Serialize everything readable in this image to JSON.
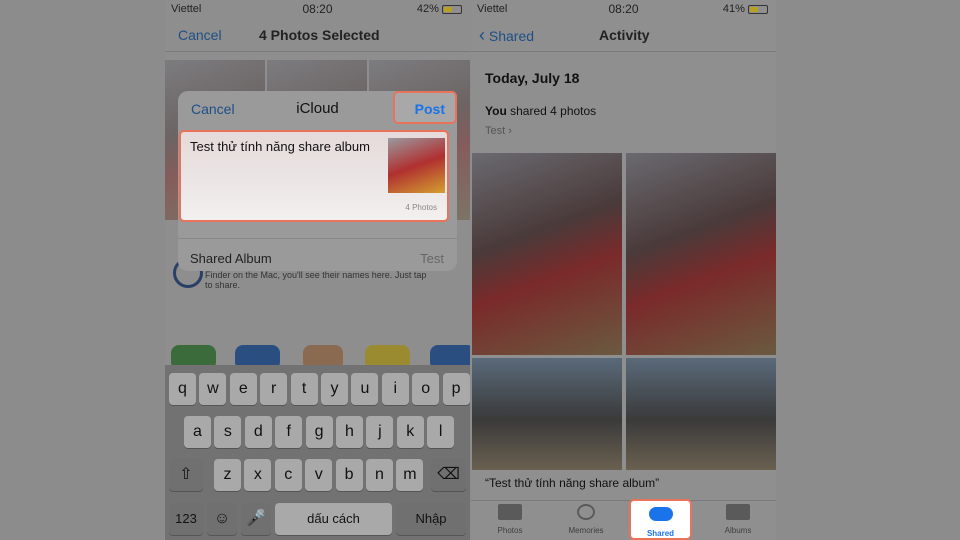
{
  "left": {
    "status": {
      "carrier": "Viettel",
      "time": "08:20",
      "battery": "42%"
    },
    "nav": {
      "cancel": "Cancel",
      "title": "4 Photos Selected"
    },
    "sheet": {
      "cancel": "Cancel",
      "title": "iCloud",
      "post": "Post",
      "message": "Test thử tính năng share album",
      "photo_count": "4 Photos",
      "album_label": "Shared Album",
      "album_value": "Test"
    },
    "airdrop_hint": "Finder on the Mac, you'll see their names here. Just tap to share.",
    "keyboard": {
      "row1": [
        "q",
        "w",
        "e",
        "r",
        "t",
        "y",
        "u",
        "i",
        "o",
        "p"
      ],
      "row2": [
        "a",
        "s",
        "d",
        "f",
        "g",
        "h",
        "j",
        "k",
        "l"
      ],
      "row3": [
        "z",
        "x",
        "c",
        "v",
        "b",
        "n",
        "m"
      ],
      "numbers": "123",
      "space": "dấu cách",
      "return": "Nhập"
    }
  },
  "right": {
    "status": {
      "carrier": "Viettel",
      "time": "08:20",
      "battery": "41%"
    },
    "nav": {
      "back": "Shared",
      "title": "Activity"
    },
    "date": "Today, July 18",
    "you": "You",
    "shared_text": " shared 4 photos",
    "album": "Test",
    "caption": "“Test thử tính năng share album”",
    "tabs": [
      {
        "label": "Photos"
      },
      {
        "label": "Memories"
      },
      {
        "label": "Shared"
      },
      {
        "label": "Albums"
      }
    ],
    "accent": "#1a73e8",
    "highlight": "#e8735a"
  }
}
